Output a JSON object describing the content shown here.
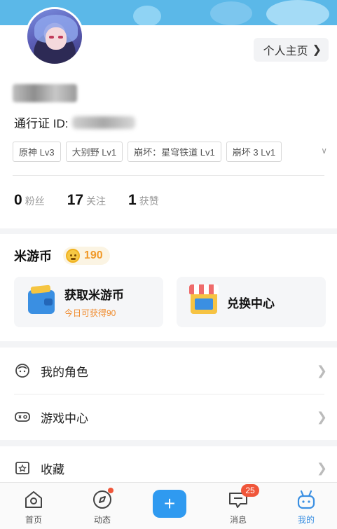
{
  "profile": {
    "home_button_label": "个人主页",
    "pass_id_label": "通行证 ID:",
    "game_tags": [
      "原神 Lv3",
      "大别野 Lv1",
      "崩坏：星穹铁道 Lv1",
      "崩坏 3 Lv1"
    ],
    "stats": [
      {
        "num": "0",
        "label": "粉丝"
      },
      {
        "num": "17",
        "label": "关注"
      },
      {
        "num": "1",
        "label": "获赞"
      }
    ]
  },
  "coins": {
    "title": "米游币",
    "balance": "190",
    "earn": {
      "label": "获取米游币",
      "sub": "今日可获得90"
    },
    "exchange": {
      "label": "兑换中心"
    }
  },
  "menu": {
    "my_roles": "我的角色",
    "game_center": "游戏中心",
    "favorites": "收藏"
  },
  "bottom_nav": {
    "home": "首页",
    "dynamics": "动态",
    "messages": "消息",
    "messages_badge": "25",
    "mine": "我的"
  },
  "colors": {
    "accent": "#2f9af0",
    "coin": "#f19a2a",
    "badge": "#f0563a"
  }
}
